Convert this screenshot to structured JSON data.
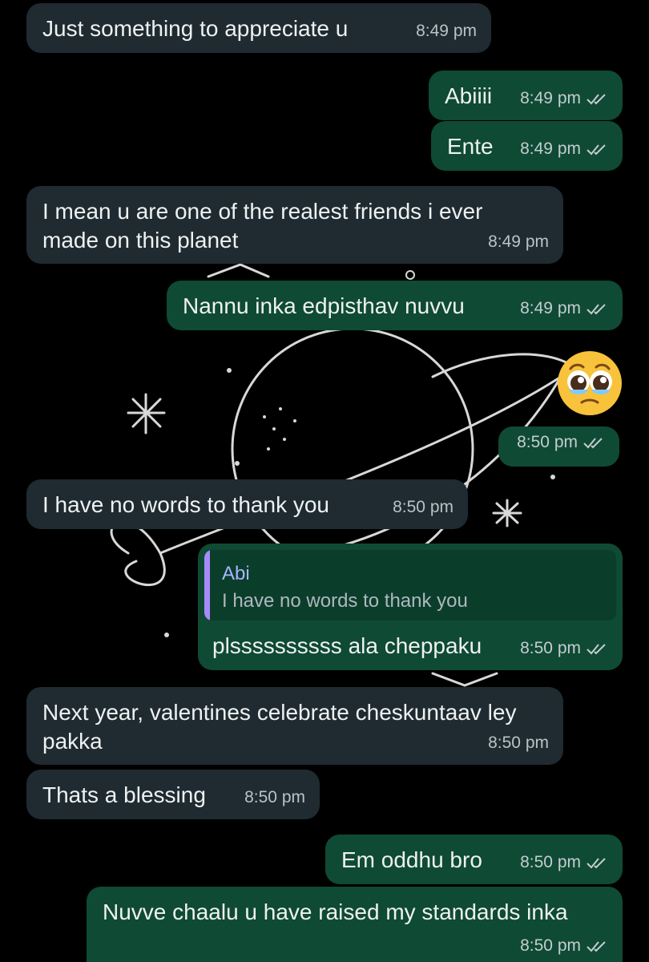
{
  "messages": [
    {
      "id": "m1",
      "dir": "in",
      "text": "Just something to appreciate u",
      "time": "8:49 pm"
    },
    {
      "id": "m2",
      "dir": "out",
      "text": "Abiiii",
      "time": "8:49 pm"
    },
    {
      "id": "m3",
      "dir": "out",
      "text": "Ente",
      "time": "8:49 pm"
    },
    {
      "id": "m4",
      "dir": "in",
      "text": "I mean u are one of the realest friends i ever made on this planet",
      "time": "8:49 pm"
    },
    {
      "id": "m5",
      "dir": "out",
      "text": "Nannu inka edpisthav nuvvu",
      "time": "8:49 pm"
    },
    {
      "id": "m6",
      "dir": "out",
      "text": "",
      "time": "8:50 pm",
      "emoji": "pleading-face-with-tears-emoji"
    },
    {
      "id": "m7",
      "dir": "in",
      "text": "I have no words to thank you",
      "time": "8:50 pm"
    },
    {
      "id": "m8",
      "dir": "out",
      "text": "plssssssssss ala cheppaku",
      "time": "8:50 pm",
      "quote": {
        "name": "Abi",
        "text": "I have no words to thank you"
      }
    },
    {
      "id": "m9",
      "dir": "in",
      "text": "Next year, valentines celebrate cheskuntaav ley pakka",
      "time": "8:50 pm"
    },
    {
      "id": "m10",
      "dir": "in",
      "text": "Thats a blessing",
      "time": "8:50 pm"
    },
    {
      "id": "m11",
      "dir": "out",
      "text": "Em oddhu bro",
      "time": "8:50 pm"
    },
    {
      "id": "m12",
      "dir": "out",
      "text": "Nuvve chaalu u have raised my standards inka",
      "time": "8:50 pm"
    }
  ],
  "colors": {
    "background": "#000000",
    "incoming_bubble": "#1f2b31",
    "outgoing_bubble": "#0f4a34",
    "quote_accent": "#a78bfa"
  },
  "icons": {
    "read_receipt": "double-check-icon",
    "wallpaper": "planet-doodle-wallpaper"
  }
}
